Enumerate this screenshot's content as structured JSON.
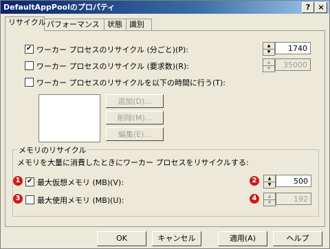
{
  "title": "DefaultAppPoolのプロパティ",
  "title_buttons": {
    "help": "?",
    "close": "×"
  },
  "tabs": [
    {
      "label": "リサイクル",
      "active": true
    },
    {
      "label": "パフォーマンス",
      "active": false
    },
    {
      "label": "状態",
      "active": false
    },
    {
      "label": "識別",
      "active": false
    }
  ],
  "recycle": {
    "minutes": {
      "label": "ワーカー プロセスのリサイクル (分ごと)(P):",
      "checked": true,
      "value": "1740"
    },
    "requests": {
      "label": "ワーカー プロセスのリサイクル (要求数)(R):",
      "checked": false,
      "value": "35000"
    },
    "schedule": {
      "label": "ワーカー プロセスのリサイクルを以下の時間に行う(T):",
      "checked": false
    },
    "buttons": {
      "add": "追加(D)...",
      "delete": "削除(M)...",
      "edit": "編集(E)..."
    }
  },
  "memory": {
    "group_title": "メモリのリサイクル",
    "description": "メモリを大量に消費したときにワーカー プロセスをリサイクルする:",
    "virtual": {
      "label": "最大仮想メモリ (MB)(V):",
      "checked": true,
      "value": "500"
    },
    "used": {
      "label": "最大使用メモリ (MB)(U):",
      "checked": false,
      "value": "192"
    }
  },
  "badges": [
    "1",
    "2",
    "3",
    "4"
  ],
  "footer": {
    "ok": "OK",
    "cancel": "キャンセル",
    "apply": "適用(A)",
    "help": "ヘルプ"
  },
  "colors": {
    "title_bar": "#0a246a",
    "badge": "#cc1b1b",
    "face": "#ece9d8"
  }
}
